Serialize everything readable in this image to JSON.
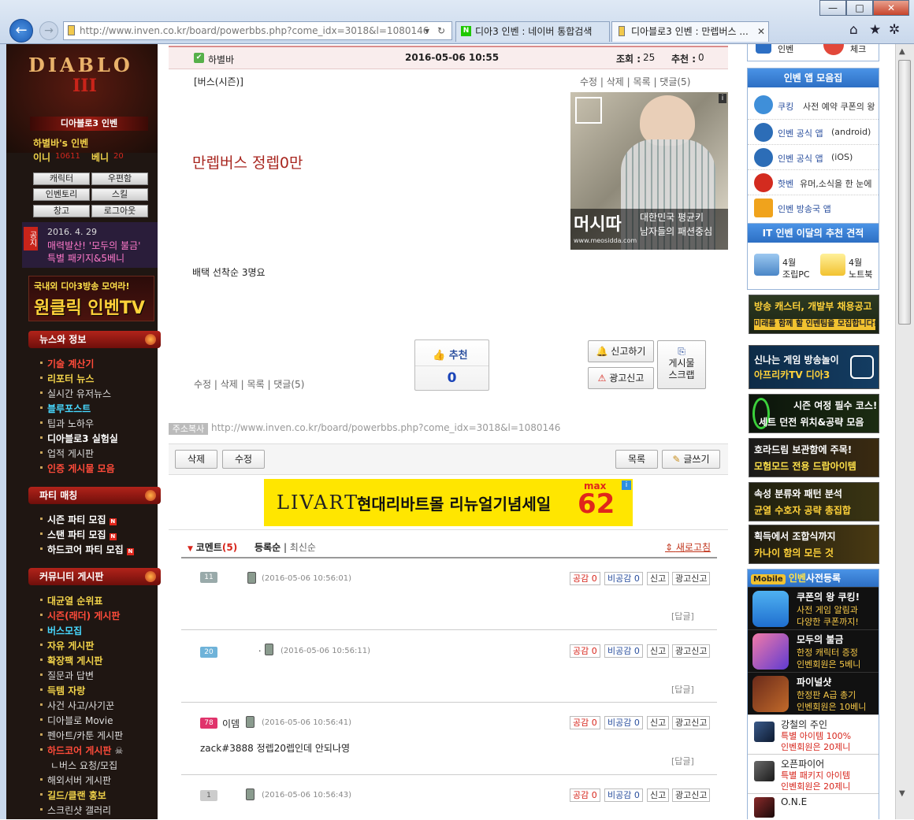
{
  "browser": {
    "url": "http://www.inven.co.kr/board/powerbbs.php?come_idx=3018&l=1080146",
    "tabs": [
      {
        "label": "디아3 인벤 : 네이버 통합검색"
      },
      {
        "label": "디아블로3 인벤 : 만렙버스 ..."
      }
    ],
    "window_buttons": {
      "minimize": "—",
      "maximize": "□",
      "close": "✕"
    }
  },
  "left": {
    "logo": "DIABLO",
    "logo_sub": "III",
    "site_badge": "디아블로3 인벤",
    "user_title": "하별바's 인벤",
    "mini_label": "이니",
    "mini_value": "10611",
    "beni_label": "베니",
    "beni_value": "20",
    "buttons": [
      "캐릭터",
      "우편함",
      "인벤토리",
      "스킬",
      "창고",
      "로그아웃"
    ],
    "notice_tag": "공지",
    "notice_date": "2016. 4. 29",
    "notice_line1": "매력발산! '모두의 불금'",
    "notice_line2": "특별 패키지&5베니",
    "tv_banner_top": "국내외 디아3방송 모여라!",
    "tv_banner_main": "원클릭 인벤TV",
    "news_head": "뉴스와 정보",
    "news": [
      "기술 계산기",
      "리포터 뉴스",
      "실시간 유저뉴스",
      "블루포스트",
      "팁과 노하우",
      "디아블로3 실험실",
      "업적 게시판",
      "인증 게시물 모음"
    ],
    "party_head": "파티 매칭",
    "party": [
      "시즌 파티 모집",
      "스탠 파티 모집",
      "하드코어 파티 모집"
    ],
    "new_badge": "N",
    "community_head": "커뮤니티 게시판",
    "community": [
      "대균열 순위표",
      "시즌(래더) 게시판",
      "버스모집",
      "자유 게시판",
      "확장팩 게시판",
      "질문과 답변",
      "득템 자랑",
      "사건 사고/사기꾼",
      "디아블로 Movie",
      "펜아트/카툰 게시판",
      "하드코어 게시판",
      "ㄴ버스 요청/모집",
      "해외서버 게시판",
      "길드/클랜 홍보",
      "스크린샷 갤러리"
    ]
  },
  "post": {
    "author": "하별바",
    "datetime": "2016-05-06 10:55",
    "views_label": "조회 :",
    "views": "25",
    "recommend_label": "추천 :",
    "recommend": "0",
    "category": "[버스(시즌)]",
    "actions_top": [
      "수정",
      "삭제",
      "목록",
      "댓글(5)"
    ],
    "title": "만렙버스 정렙0만",
    "body": "배택 선착순 3명요",
    "ad_brand": "머시따",
    "ad_copy1": "대한민국 평균키",
    "ad_copy2": "남자들의 패션중심",
    "ad_url": "www.meosidda.com",
    "ad_info": "i",
    "recommend_btn": "추천",
    "recommend_count": "0",
    "report_btn": "신고하기",
    "ad_report_btn": "광고신고",
    "scrap_btn1": "게시물",
    "scrap_btn2": "스크랩",
    "actions_bottom": [
      "수정",
      "삭제",
      "목록",
      "댓글(5)"
    ],
    "addr_label": "주소복사",
    "addr": "http://www.inven.co.kr/board/powerbbs.php?come_idx=3018&l=1080146"
  },
  "toolbar": {
    "delete": "삭제",
    "edit": "수정",
    "list": "목록",
    "write": "글쓰기"
  },
  "banner_ad": {
    "brand": "LIVART",
    "copy": "현대리바트몰 리뉴얼기념세일",
    "max": "max",
    "percent": "62"
  },
  "comments": {
    "label": "코멘트",
    "count": "(5)",
    "sort_reg": "등록순",
    "sort_new": "최신순",
    "refresh": "새로고침",
    "btn_like": "공감 0",
    "btn_dislike": "비공감 0",
    "btn_report": "신고",
    "btn_ad": "광고신고",
    "reply": "[답글]",
    "items": [
      {
        "level": "11",
        "name": "",
        "time": "(2016-05-06 10:56:01)",
        "text": ""
      },
      {
        "level": "20",
        "name": "·",
        "time": "(2016-05-06 10:56:11)",
        "text": ""
      },
      {
        "level": "78",
        "name": "이뎀",
        "time": "(2016-05-06 10:56:41)",
        "text": "zack#3888 정렙20렙인데 안되나영"
      },
      {
        "level": "1",
        "name": "",
        "time": "(2016-05-06 10:56:43)",
        "text": ""
      }
    ]
  },
  "right": {
    "top_items": [
      "인벤",
      "체크"
    ],
    "app_head": "인벤 앱 모음집",
    "apps": [
      {
        "name": "쿠킹",
        "desc": "사전 예약 쿠폰의 왕",
        "color": "#3f8fd9"
      },
      {
        "name": "인벤 공식 앱",
        "desc": "(android)",
        "color": "#2c6db7"
      },
      {
        "name": "인벤 공식 앱",
        "desc": "(iOS)",
        "color": "#2c6db7"
      },
      {
        "name": "핫벤",
        "desc": "유머,소식을 한 눈에",
        "color": "#d32b1f"
      },
      {
        "name": "인벤 방송국 앱",
        "desc": "",
        "color": "#f0a31c"
      }
    ],
    "it_head": "IT 인벤 이달의 추천 견적",
    "it_items": [
      {
        "l1": "4월",
        "l2": "조립PC"
      },
      {
        "l1": "4월",
        "l2": "노트북"
      }
    ],
    "banners": [
      {
        "t1": "방송 캐스터, 개발부 채용공고",
        "t2": "미래를 함께 할 인벤팀을 모집합니다!"
      },
      {
        "t1": "신나는 게임 방송놀이",
        "t2": "아프리카TV 디아3"
      },
      {
        "t1": "시즌 여정 필수 코스!",
        "t2": "세트 던전 위치&공략 모음"
      },
      {
        "t1": "호라드림 보관함에 주목!",
        "t2": "모험모드 전용 드랍아이템"
      },
      {
        "t1": "속성 분류와 패턴 분석",
        "t2": "균열 수호자 공략 총집합"
      },
      {
        "t1": "획득에서 조합식까지",
        "t2": "카나이 함의 모든 것"
      }
    ],
    "mobile_tag": "Mobile",
    "mobile_inven": "인벤",
    "mobile_head": "사전등록",
    "mobile_items": [
      {
        "t1": "쿠폰의 왕 쿠킹!",
        "t2": "사전 게임 알림과",
        "t3": "다양한 쿠폰까지!"
      },
      {
        "t1": "모두의 불금",
        "t2": "한정 캐릭터 증정",
        "t3": "인벤회원은 5베니"
      },
      {
        "t1": "파이널샷",
        "t2": "한정판 A급 총기",
        "t3": "인벤회원은 10베니"
      },
      {
        "t1": "강철의 주인",
        "t2": "특별 아이템 100%",
        "t3": "인벤회원은 20제니"
      },
      {
        "t1": "오픈파이어",
        "t2": "특별 패키지 아이템",
        "t3": "인벤회원은 20제니"
      },
      {
        "t1": "O.N.E",
        "t2": "",
        "t3": ""
      }
    ]
  },
  "colors": {
    "accent_red": "#a8261f",
    "link_blue": "#2a4f9e",
    "post_header_bg": "#f9eded"
  }
}
